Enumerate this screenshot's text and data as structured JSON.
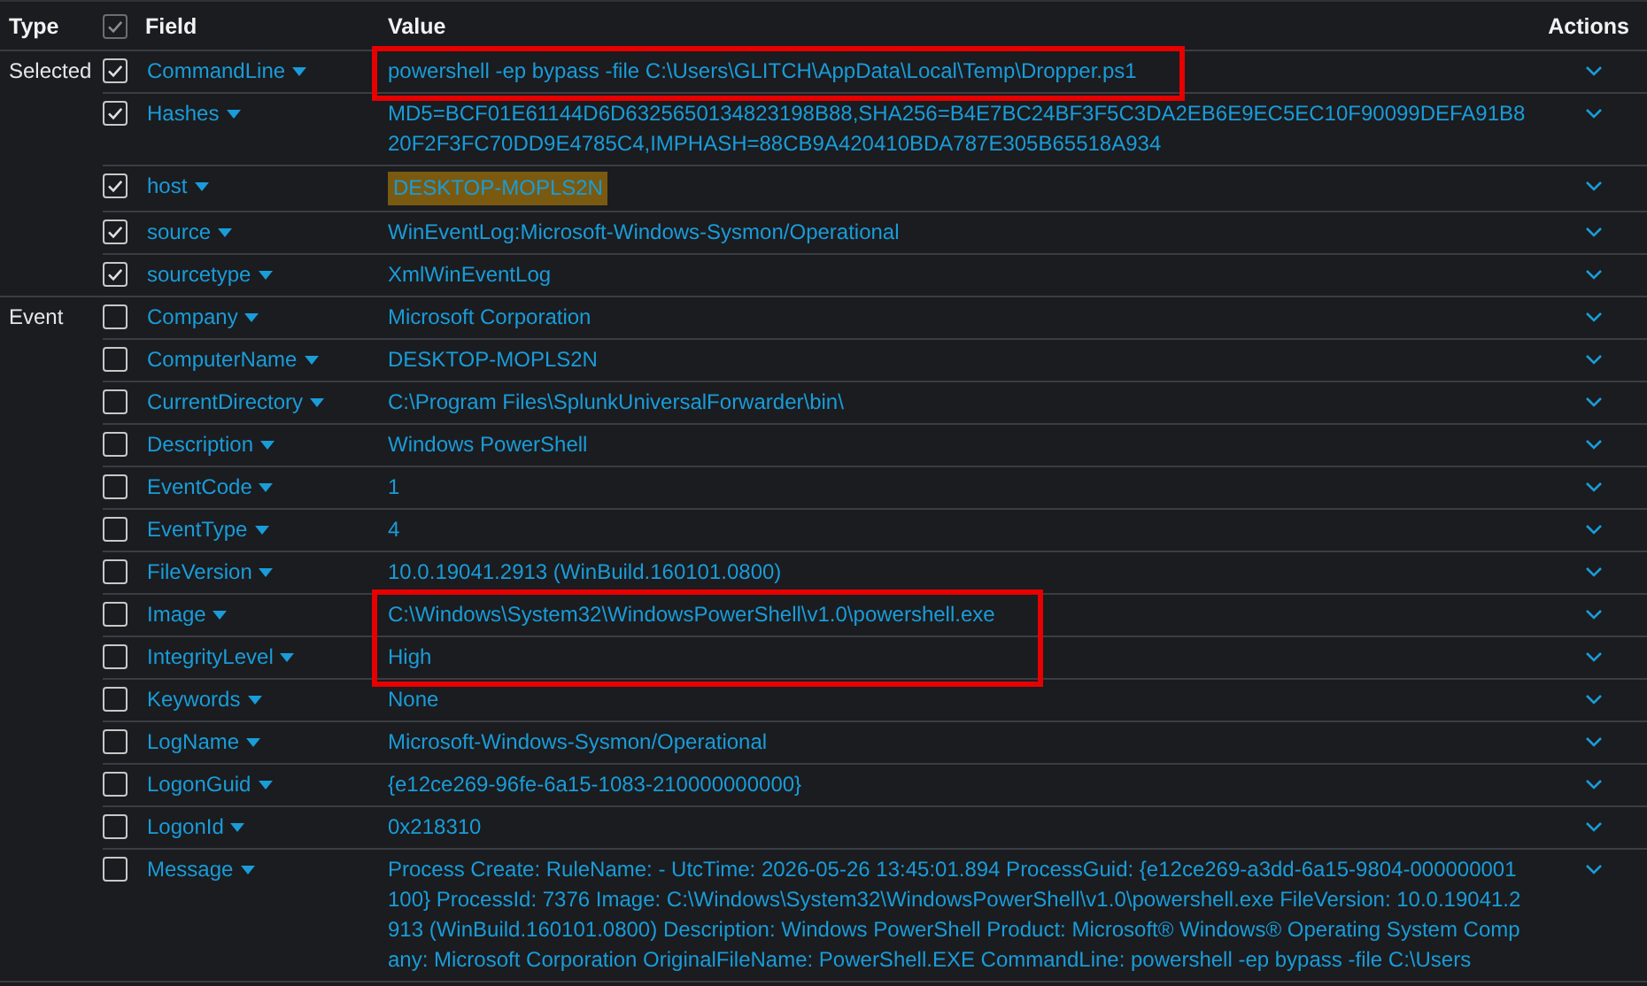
{
  "header": {
    "type": "Type",
    "select_all": {
      "checked": true
    },
    "field": "Field",
    "value": "Value",
    "actions": "Actions"
  },
  "groups": [
    {
      "type": "Selected",
      "fields": [
        {
          "name": "CommandLine",
          "checked": true,
          "value": "powershell -ep bypass -file C:\\Users\\GLITCH\\AppData\\Local\\Temp\\Dropper.ps1",
          "highlighted": false,
          "boxed": true
        },
        {
          "name": "Hashes",
          "checked": true,
          "value": "MD5=BCF01E61144D6D6325650134823198B88,SHA256=B4E7BC24BF3F5C3DA2EB6E9EC5EC10F90099DEFA91B820F2F3FC70DD9E4785C4,IMPHASH=88CB9A420410BDA787E305B65518A934",
          "highlighted": false,
          "boxed": false
        },
        {
          "name": "host",
          "checked": true,
          "value": "DESKTOP-MOPLS2N",
          "highlighted": true,
          "boxed": false
        },
        {
          "name": "source",
          "checked": true,
          "value": "WinEventLog:Microsoft-Windows-Sysmon/Operational",
          "highlighted": false,
          "boxed": false
        },
        {
          "name": "sourcetype",
          "checked": true,
          "value": "XmlWinEventLog",
          "highlighted": false,
          "boxed": false
        }
      ]
    },
    {
      "type": "Event",
      "fields": [
        {
          "name": "Company",
          "checked": false,
          "value": "Microsoft Corporation",
          "highlighted": false,
          "boxed": false
        },
        {
          "name": "ComputerName",
          "checked": false,
          "value": "DESKTOP-MOPLS2N",
          "highlighted": false,
          "boxed": false
        },
        {
          "name": "CurrentDirectory",
          "checked": false,
          "value": "C:\\Program Files\\SplunkUniversalForwarder\\bin\\",
          "highlighted": false,
          "boxed": false
        },
        {
          "name": "Description",
          "checked": false,
          "value": "Windows PowerShell",
          "highlighted": false,
          "boxed": false
        },
        {
          "name": "EventCode",
          "checked": false,
          "value": "1",
          "highlighted": false,
          "boxed": false
        },
        {
          "name": "EventType",
          "checked": false,
          "value": "4",
          "highlighted": false,
          "boxed": false
        },
        {
          "name": "FileVersion",
          "checked": false,
          "value": "10.0.19041.2913 (WinBuild.160101.0800)",
          "highlighted": false,
          "boxed": false
        },
        {
          "name": "Image",
          "checked": false,
          "value": "C:\\Windows\\System32\\WindowsPowerShell\\v1.0\\powershell.exe",
          "highlighted": false,
          "boxed": true
        },
        {
          "name": "IntegrityLevel",
          "checked": false,
          "value": "High",
          "highlighted": false,
          "boxed": true
        },
        {
          "name": "Keywords",
          "checked": false,
          "value": "None",
          "highlighted": false,
          "boxed": false
        },
        {
          "name": "LogName",
          "checked": false,
          "value": "Microsoft-Windows-Sysmon/Operational",
          "highlighted": false,
          "boxed": false
        },
        {
          "name": "LogonGuid",
          "checked": false,
          "value": "{e12ce269-96fe-6a15-1083-210000000000}",
          "highlighted": false,
          "boxed": false
        },
        {
          "name": "LogonId",
          "checked": false,
          "value": "0x218310",
          "highlighted": false,
          "boxed": false
        },
        {
          "name": "Message",
          "checked": false,
          "value": "Process Create: RuleName: - UtcTime: 2026-05-26 13:45:01.894 ProcessGuid: {e12ce269-a3dd-6a15-9804-000000001100} ProcessId: 7376 Image: C:\\Windows\\System32\\WindowsPowerShell\\v1.0\\powershell.exe FileVersion: 10.0.19041.2913 (WinBuild.160101.0800) Description: Windows PowerShell Product: Microsoft® Windows® Operating System Company: Microsoft Corporation OriginalFileName: PowerShell.EXE CommandLine: powershell -ep bypass -file C:\\Users",
          "highlighted": false,
          "boxed": false
        }
      ]
    }
  ]
}
